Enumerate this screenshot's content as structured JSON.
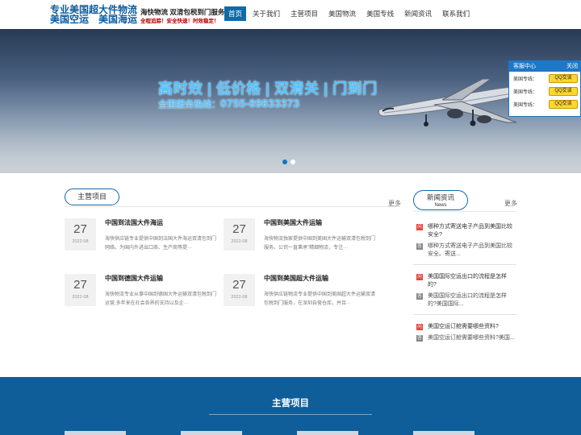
{
  "header": {
    "logo_line1": "专业美国超大件物流",
    "logo_line2": "美国空运　美国海运",
    "slogan_line1": "海快物流  双清包税到门服务",
    "slogan_line2": "全程追踪！安全快速！时效稳定！"
  },
  "nav": {
    "items": [
      "首页",
      "关于我们",
      "主营项目",
      "美国物流",
      "美国专线",
      "新闻资讯",
      "联系我们"
    ]
  },
  "banner": {
    "headline": "高时效 | 低价格 | 双清关 | 门到门",
    "hotline_label": "全国服务热线：",
    "hotline_number": "0755-89833373"
  },
  "customer_service": {
    "title": "客服中心",
    "close": "关闭",
    "rows": [
      {
        "label": "美国专线：",
        "button": "QQ交谈"
      },
      {
        "label": "美国专线：",
        "button": "QQ交谈"
      },
      {
        "label": "美国专线：",
        "button": "QQ交谈"
      }
    ]
  },
  "main": {
    "title": "主营项目",
    "more": "更多",
    "cards": [
      {
        "day": "27",
        "ym": "2022-08",
        "title": "中国到法国大件海运",
        "desc": "海快供应链专业提供中国到法国大件海运双清包到门网络。为国内外进出口商、生产商等提···"
      },
      {
        "day": "27",
        "ym": "2022-08",
        "title": "中国到美国大件运输",
        "desc": "海快物流独家提供中国到美国大件运输双清包税到门服务。公司一直秉承\"精细物流，专注···"
      },
      {
        "day": "27",
        "ym": "2022-08",
        "title": "中国到德国大件运输",
        "desc": "海快物流专业从事中国到德国大件运输双清包税到门运营,多年来在社会各界的支持以及企···"
      },
      {
        "day": "27",
        "ym": "2022-08",
        "title": "中国到美国超大件运输",
        "desc": "海快供应链物流专业提供中国到美国超大件运输双清包税到门服务，在深圳自营仓库，并且···"
      }
    ]
  },
  "news": {
    "title": "新闻资讯",
    "subtitle": "News",
    "more": "更多",
    "items": [
      {
        "q": "哪种方式寄送电子产品到美国比较安全?",
        "a": "哪种方式寄送电子产品到美国比较安全。寄送..."
      },
      {
        "q": "美国国际空运出口的流程是怎样的?",
        "a": "美国国际空运出口的流程是怎样的?美国国际..."
      },
      {
        "q": "美国空运订舱需要哪些资料?",
        "a": "美国空运订舱需要哪些资料?美国..."
      }
    ]
  },
  "band": {
    "title": "主营项目"
  }
}
